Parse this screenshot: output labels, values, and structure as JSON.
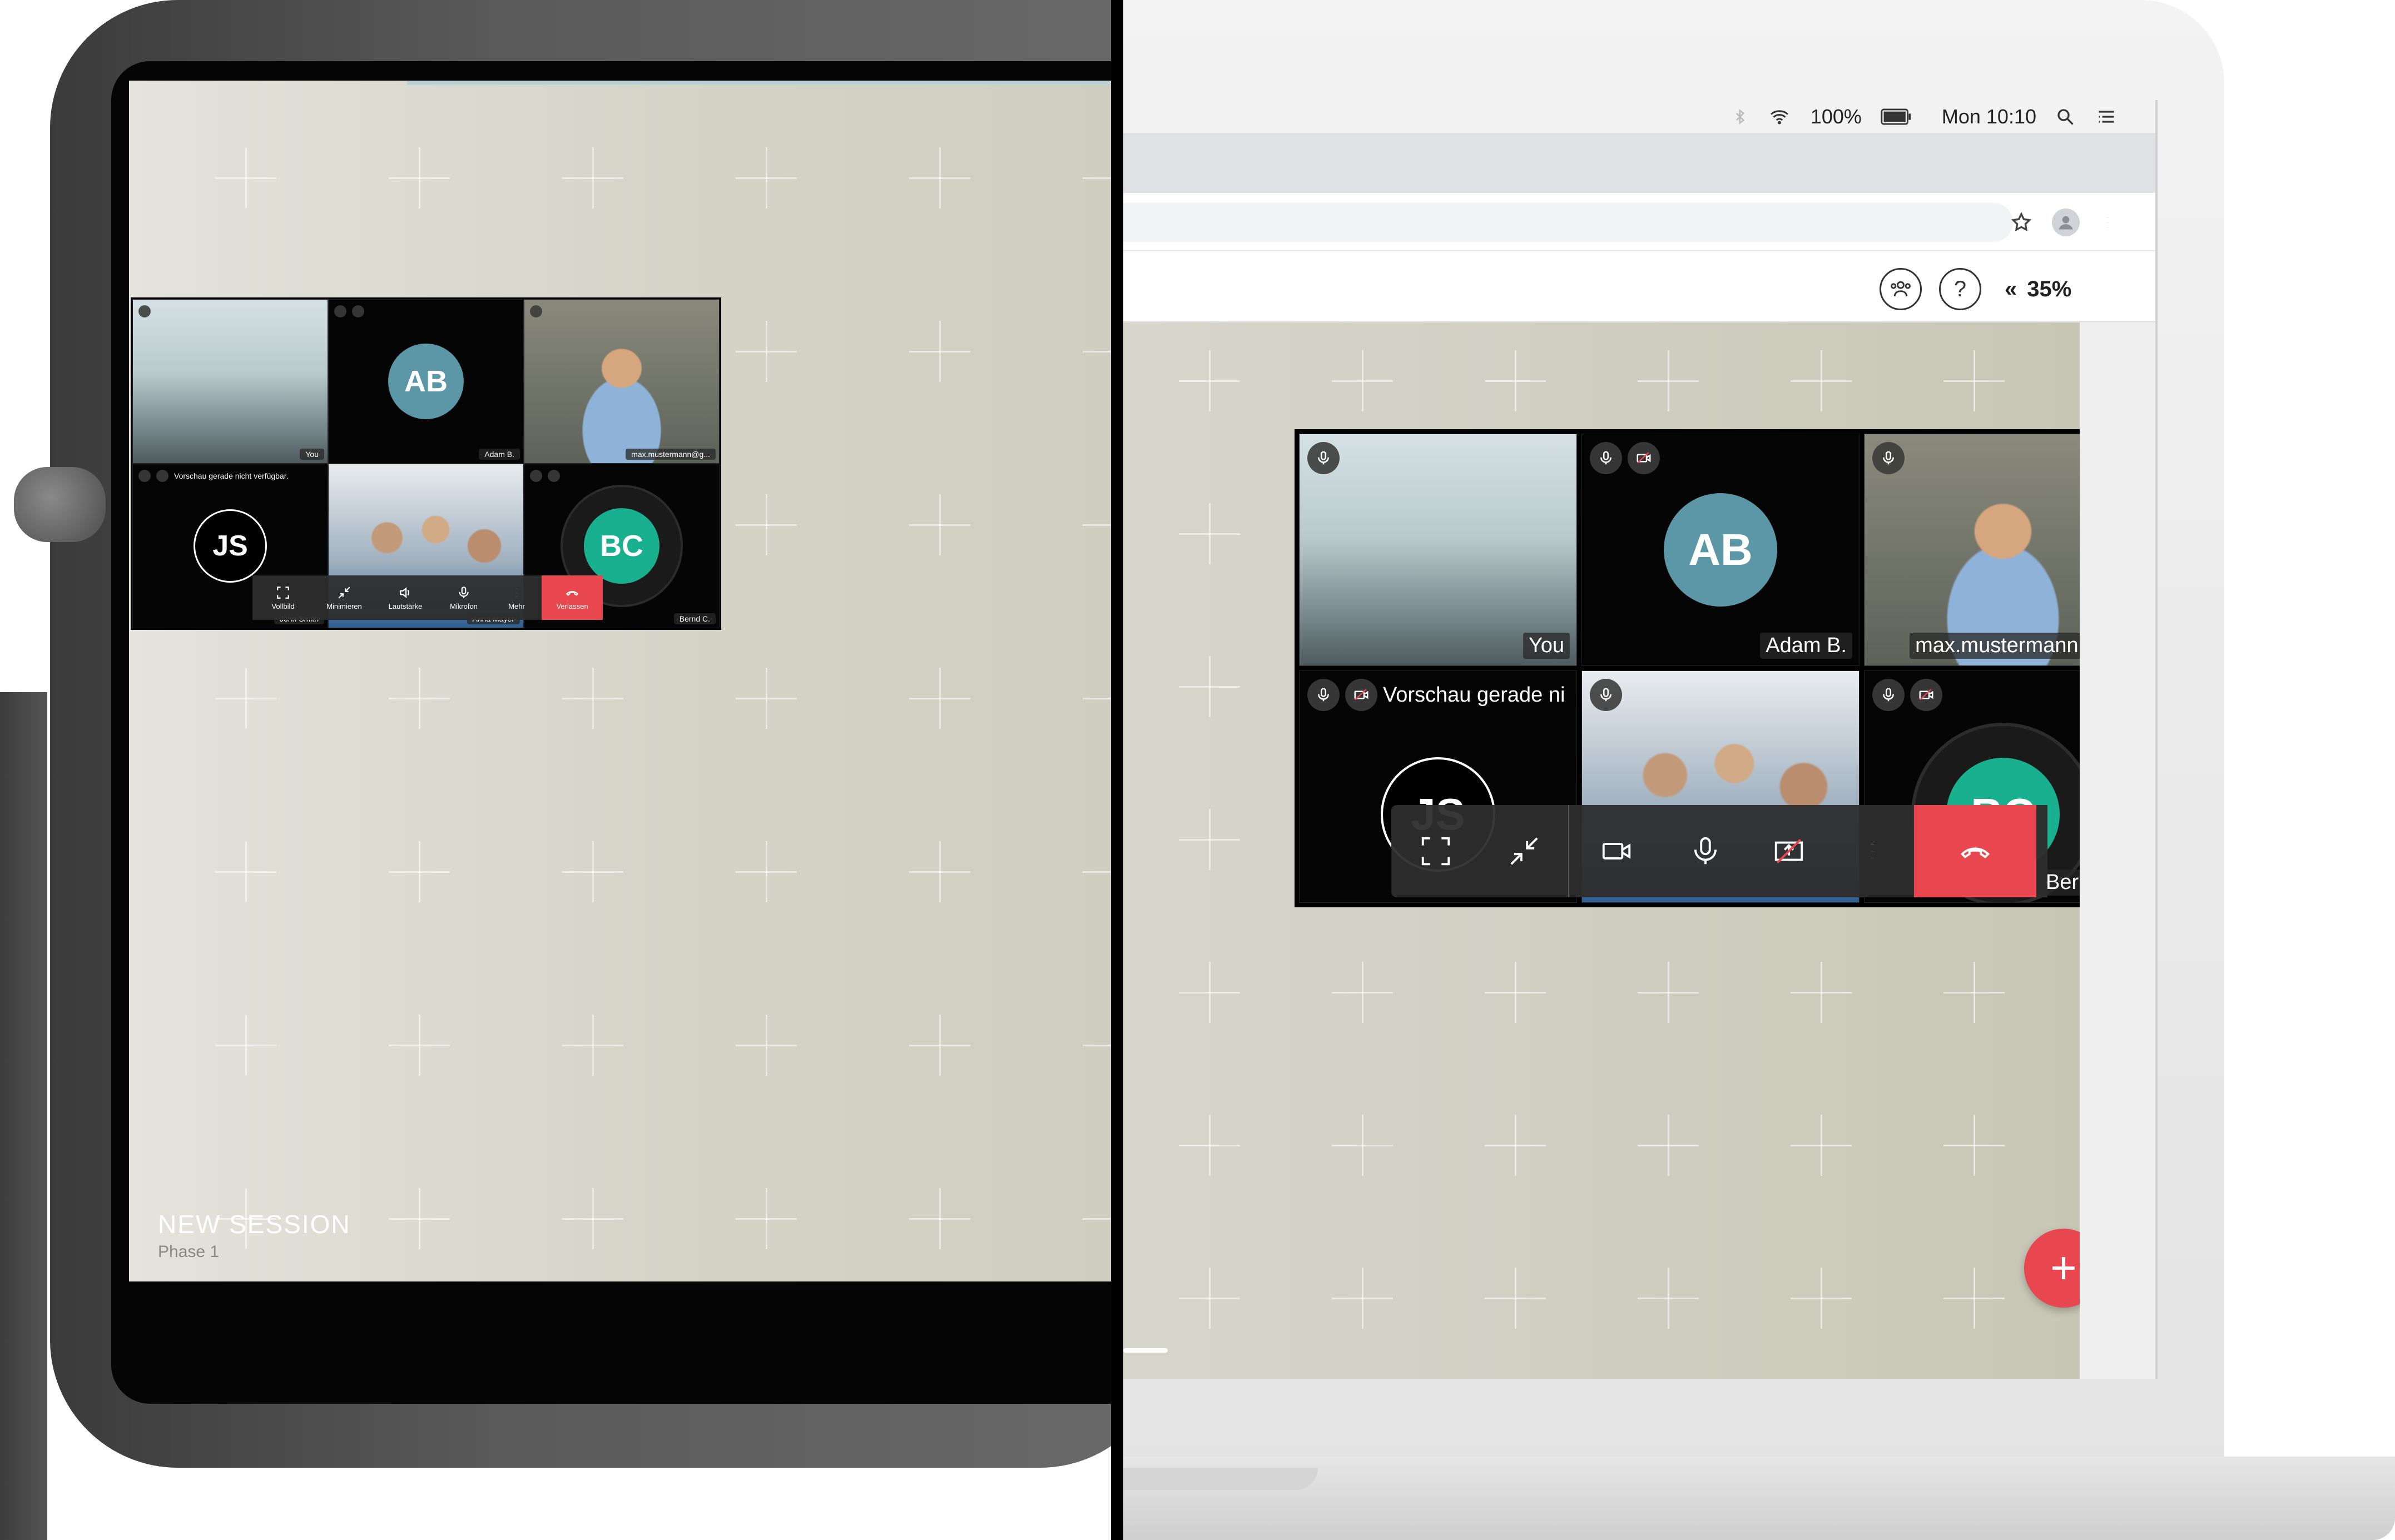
{
  "colors": {
    "accent_red": "#e8474f",
    "avatar_ab": "#5b97a6",
    "avatar_bc": "#18b08f",
    "avatar_js_ring": "#ffffff"
  },
  "display": {
    "session_title": "NEW SESSION",
    "session_phase": "Phase 1",
    "tiles": [
      {
        "name": "You",
        "initials": ""
      },
      {
        "name": "Adam B.",
        "initials": "AB"
      },
      {
        "name": "max.mustermann@g...",
        "initials": ""
      },
      {
        "name": "John Smith",
        "initials": "JS",
        "notice": "Vorschau gerade nicht verfügbar."
      },
      {
        "name": "Anna Mayer",
        "initials": ""
      },
      {
        "name": "Bernd C.",
        "initials": "BC"
      }
    ],
    "controls": {
      "fullscreen": "Vollbild",
      "minimize": "Minimieren",
      "volume": "Lautstärke",
      "mic": "Mikrofon",
      "more": "Mehr",
      "leave": "Verlassen"
    }
  },
  "laptop": {
    "menubar": {
      "battery": "100%",
      "clock": "Mon 10:10"
    },
    "header": {
      "help": "?",
      "collapse": "«",
      "zoom": "35%"
    },
    "tiles": [
      {
        "name": "You",
        "initials": ""
      },
      {
        "name": "Adam B.",
        "initials": "AB"
      },
      {
        "name": "max.mustermann@g...",
        "initials": ""
      },
      {
        "name": "",
        "initials": "JS",
        "notice": "Vorschau gerade ni"
      },
      {
        "name": "",
        "initials": ""
      },
      {
        "name": "Bernd C.",
        "initials": "BC"
      }
    ],
    "fab": "+"
  }
}
